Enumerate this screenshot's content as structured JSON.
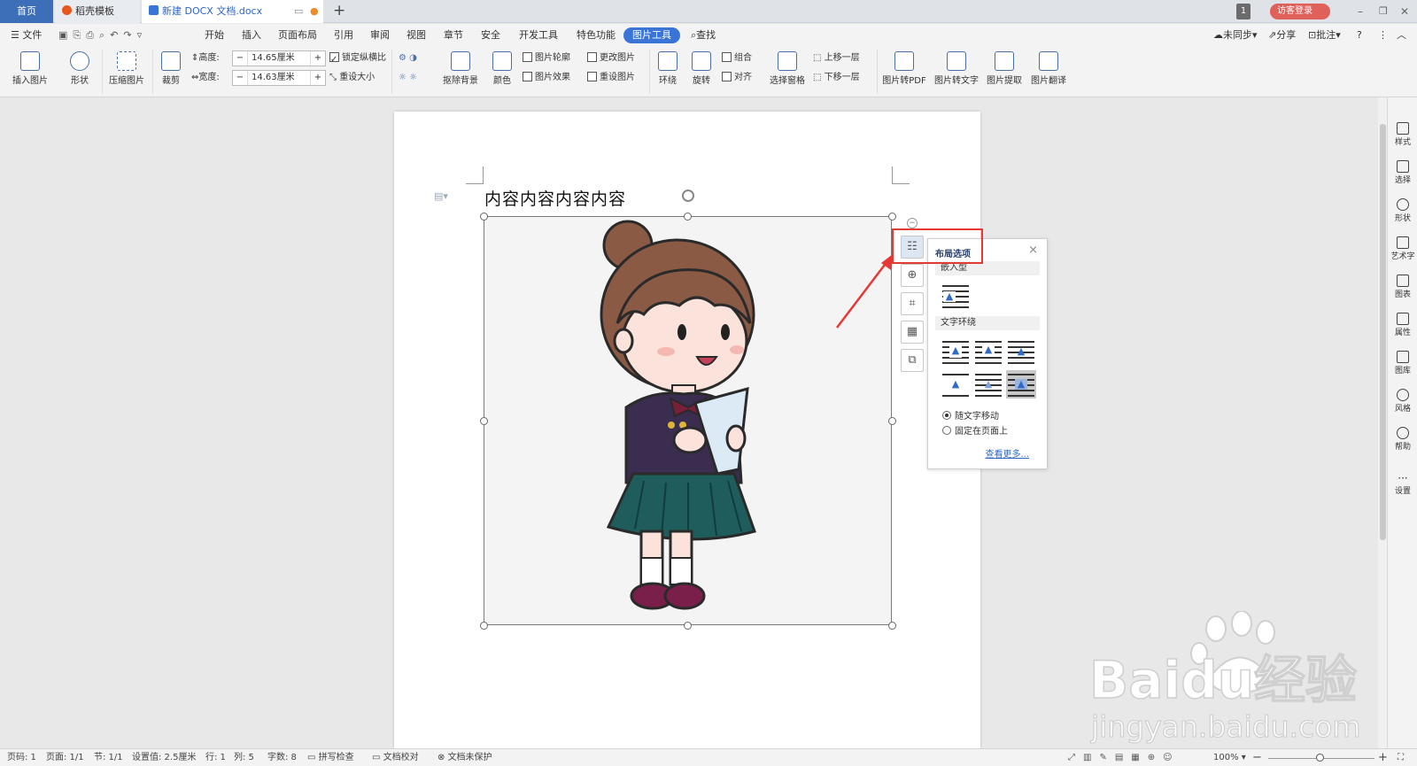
{
  "tabs": {
    "home": "首页",
    "template": "稻壳模板",
    "document": "新建 DOCX 文档.docx",
    "new_tab": "+"
  },
  "titlebar": {
    "badge": "1",
    "login": "访客登录"
  },
  "menu": {
    "file": "文件",
    "items": [
      "开始",
      "插入",
      "页面布局",
      "引用",
      "审阅",
      "视图",
      "章节",
      "安全",
      "开发工具",
      "特色功能"
    ],
    "active": "图片工具",
    "search": "查找",
    "sync": "未同步",
    "share": "分享",
    "comment": "批注"
  },
  "ribbon": {
    "insert_picture": "插入图片",
    "shape": "形状",
    "compress": "压缩图片",
    "crop": "裁剪",
    "height_label": "高度:",
    "height_value": "14.65厘米",
    "width_label": "宽度:",
    "width_value": "14.63厘米",
    "lock_ratio": "锁定纵横比",
    "reset_size": "重设大小",
    "remove_bg": "抠除背景",
    "color": "颜色",
    "outline": "图片轮廓",
    "effect": "图片效果",
    "change_picture": "更改图片",
    "reset_picture": "重设图片",
    "wrap": "环绕",
    "rotate": "旋转",
    "group": "组合",
    "align": "对齐",
    "selection_pane": "选择窗格",
    "bring_forward": "上移一层",
    "send_backward": "下移一层",
    "to_pdf": "图片转PDF",
    "to_text": "图片转文字",
    "extract": "图片提取",
    "translate": "图片翻译"
  },
  "document": {
    "title_text": "内容内容内容内容"
  },
  "layout_popup": {
    "title": "布局选项",
    "close": "×",
    "inline_section": "嵌入型",
    "wrap_section": "文字环绕",
    "move_with_text": "随文字移动",
    "fixed_on_page": "固定在页面上",
    "see_more": "查看更多..."
  },
  "right_panel": [
    "样式",
    "选择",
    "形状",
    "艺术字",
    "图表",
    "属性",
    "图库",
    "风格",
    "帮助",
    "设置"
  ],
  "status": {
    "page_code": "页码: 1",
    "pages": "页面: 1/1",
    "section": "节: 1/1",
    "setting": "设置值: 2.5厘米",
    "row": "行: 1",
    "col": "列: 5",
    "words": "字数: 8",
    "spell": "拼写检查",
    "proof": "文档校对",
    "protect": "文档未保护",
    "zoom": "100%"
  },
  "watermark": {
    "brand": "Baidu经验",
    "url": "jingyan.baidu.com"
  },
  "colors": {
    "accent": "#3a74d6",
    "highlight": "#e53935",
    "tab_home": "#3d6fb8",
    "login": "#e0605a"
  }
}
